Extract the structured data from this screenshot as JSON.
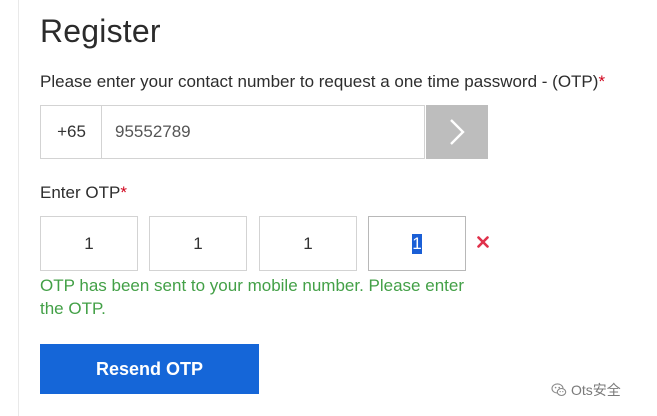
{
  "register": {
    "title": "Register",
    "contact_label": "Please enter your contact number to request a one time password - (OTP)",
    "required_mark": "*",
    "country_code": "+65",
    "phone_value": "95552789",
    "otp_label": "Enter OTP",
    "otp_digits": [
      "1",
      "1",
      "1",
      "1"
    ],
    "otp_message": "OTP has been sent to your mobile number. Please enter the OTP.",
    "resend_label": "Resend OTP"
  },
  "icons": {
    "submit": "chevron-right-icon",
    "clear": "close-icon",
    "watermark": "wechat-icon"
  },
  "watermark": {
    "text": "Ots安全"
  },
  "colors": {
    "accent_button": "#1566d8",
    "arrow_button": "#bdbdbd",
    "success_text": "#43a047",
    "required_mark": "#d0021b",
    "clear_icon": "#e0314b",
    "selection": "#1a5fd6"
  }
}
